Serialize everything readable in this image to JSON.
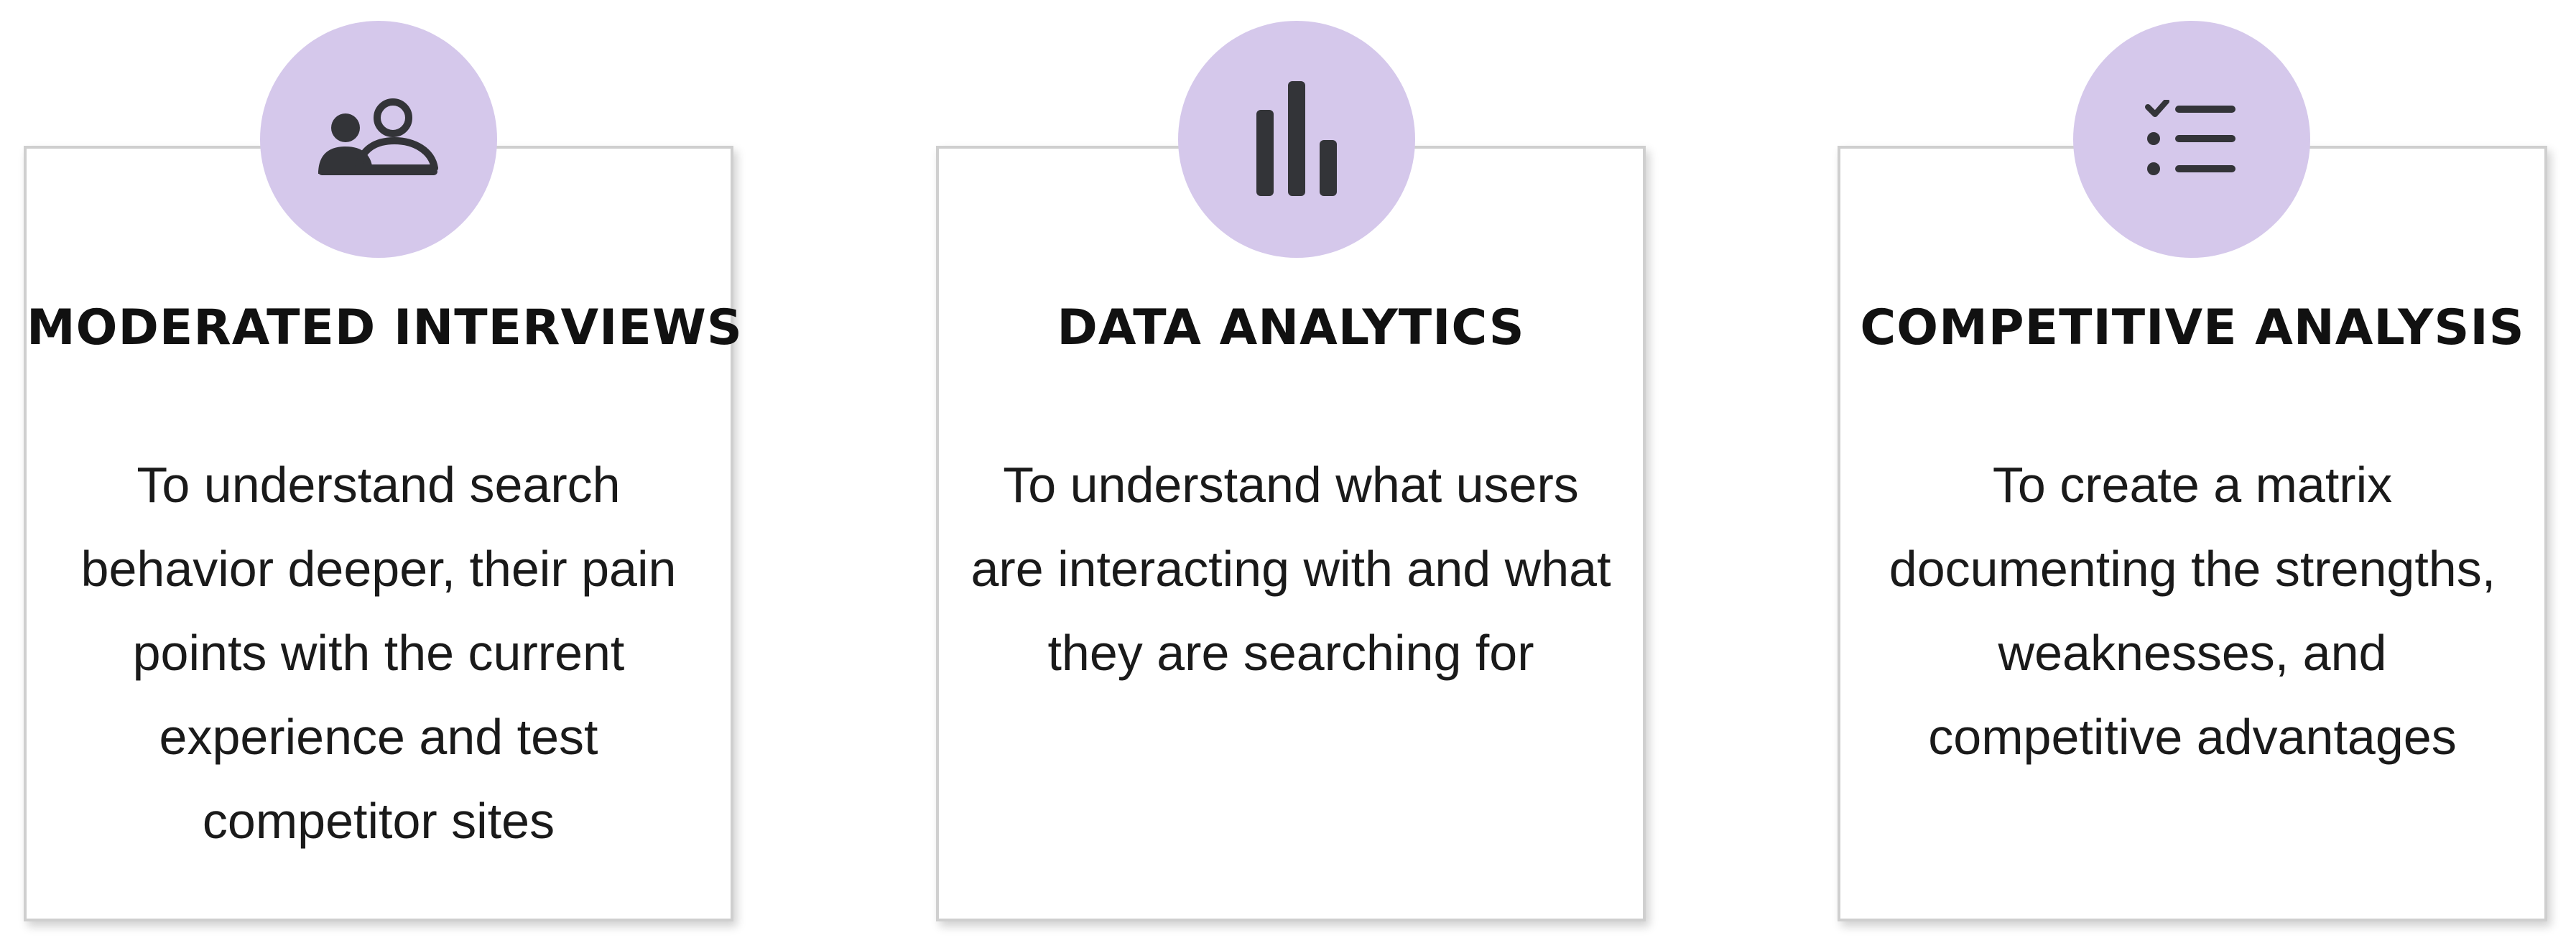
{
  "colors": {
    "icon_circle": "#d5c8eb",
    "icon_fill": "#333438",
    "card_border": "#cfcfcf",
    "title_text": "#111111",
    "body_text": "#1a1a1a"
  },
  "cards": [
    {
      "icon": "users-icon",
      "title": "MODERATED INTERVIEWS",
      "description": "To understand search behavior deeper, their pain points with the current experience and test competitor sites"
    },
    {
      "icon": "bar-chart-icon",
      "title": "DATA ANALYTICS",
      "description": "To understand what users are interacting with and what they are searching for"
    },
    {
      "icon": "checklist-icon",
      "title": "COMPETITIVE ANALYSIS",
      "description": "To create a matrix documenting the strengths, weaknesses, and competitive advantages"
    }
  ]
}
